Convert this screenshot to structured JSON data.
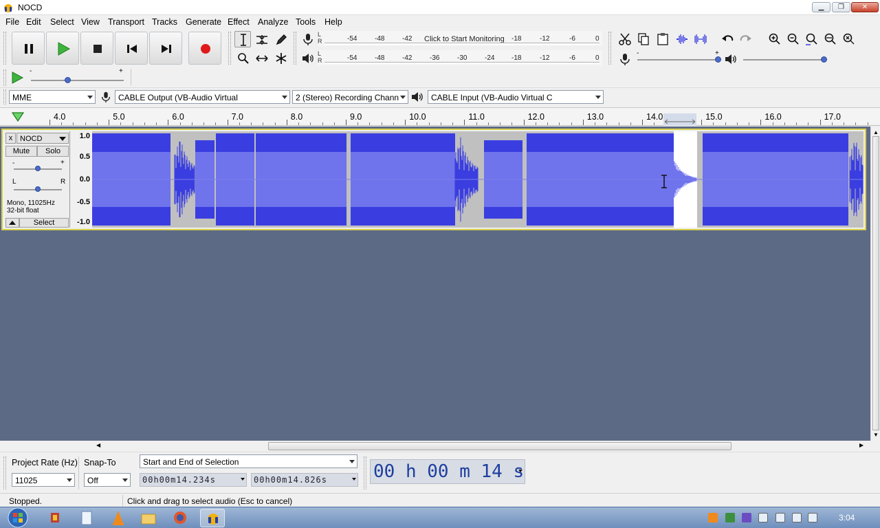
{
  "window": {
    "title": "NOCD"
  },
  "menu": [
    "File",
    "Edit",
    "Select",
    "View",
    "Transport",
    "Tracks",
    "Generate",
    "Effect",
    "Analyze",
    "Tools",
    "Help"
  ],
  "transport": {
    "buttons": [
      "pause",
      "play",
      "stop",
      "skip-to-start",
      "skip-to-end",
      "record"
    ]
  },
  "meters": {
    "record": {
      "ticks": [
        "-54",
        "-48",
        "-42",
        "Click to Start Monitoring",
        "-18",
        "-12",
        "-6",
        "0"
      ],
      "channels": [
        "L",
        "R"
      ]
    },
    "playback": {
      "ticks": [
        "-54",
        "-48",
        "-42",
        "-36",
        "-30",
        "-24",
        "-18",
        "-12",
        "-6",
        "0"
      ],
      "channels": [
        "L",
        "R"
      ]
    }
  },
  "mixer": {
    "record_volume_min": "-",
    "record_volume_max": "+",
    "record_volume": 1.0,
    "playback_volume": 1.0
  },
  "speed": {
    "min": "-",
    "max": "+",
    "value": 0.4
  },
  "devices": {
    "host": "MME",
    "recording_device": "CABLE Output (VB-Audio Virtual",
    "channels": "2 (Stereo) Recording Chann",
    "playback_device": "CABLE Input (VB-Audio Virtual C"
  },
  "ruler": {
    "labels": [
      "4.0",
      "5.0",
      "6.0",
      "7.0",
      "8.0",
      "9.0",
      "10.0",
      "11.0",
      "12.0",
      "13.0",
      "14.0",
      "15.0",
      "16.0",
      "17.0"
    ]
  },
  "track": {
    "name": "NOCD",
    "mute": "Mute",
    "solo": "Solo",
    "gain_min": "-",
    "gain_max": "+",
    "pan_left": "L",
    "pan_right": "R",
    "info_line1": "Mono, 11025Hz",
    "info_line2": "32-bit float",
    "select": "Select",
    "scale": [
      "1.0",
      "0.5",
      "0.0",
      "-0.5",
      "-1.0"
    ],
    "close": "x"
  },
  "selection": {
    "project_rate_label": "Project Rate (Hz)",
    "project_rate": "11025",
    "snap_to_label": "Snap-To",
    "snap_to": "Off",
    "mode": "Start and End of Selection",
    "start": "00h00m14.234s",
    "end": "00h00m14.826s",
    "audio_position": "00 h 00 m 14 s"
  },
  "status": {
    "state": "Stopped.",
    "hint": "Click and drag to select audio (Esc to cancel)"
  },
  "taskbar": {
    "clock": "3:04"
  },
  "colors": {
    "waveform": "#3a3ee0",
    "waveform_rms": "#6f73ec",
    "selection_bg": "#ffffff",
    "track_bg": "#c0c0c0",
    "project_bg": "#5d6a85",
    "focus_border": "#d9d04a"
  }
}
